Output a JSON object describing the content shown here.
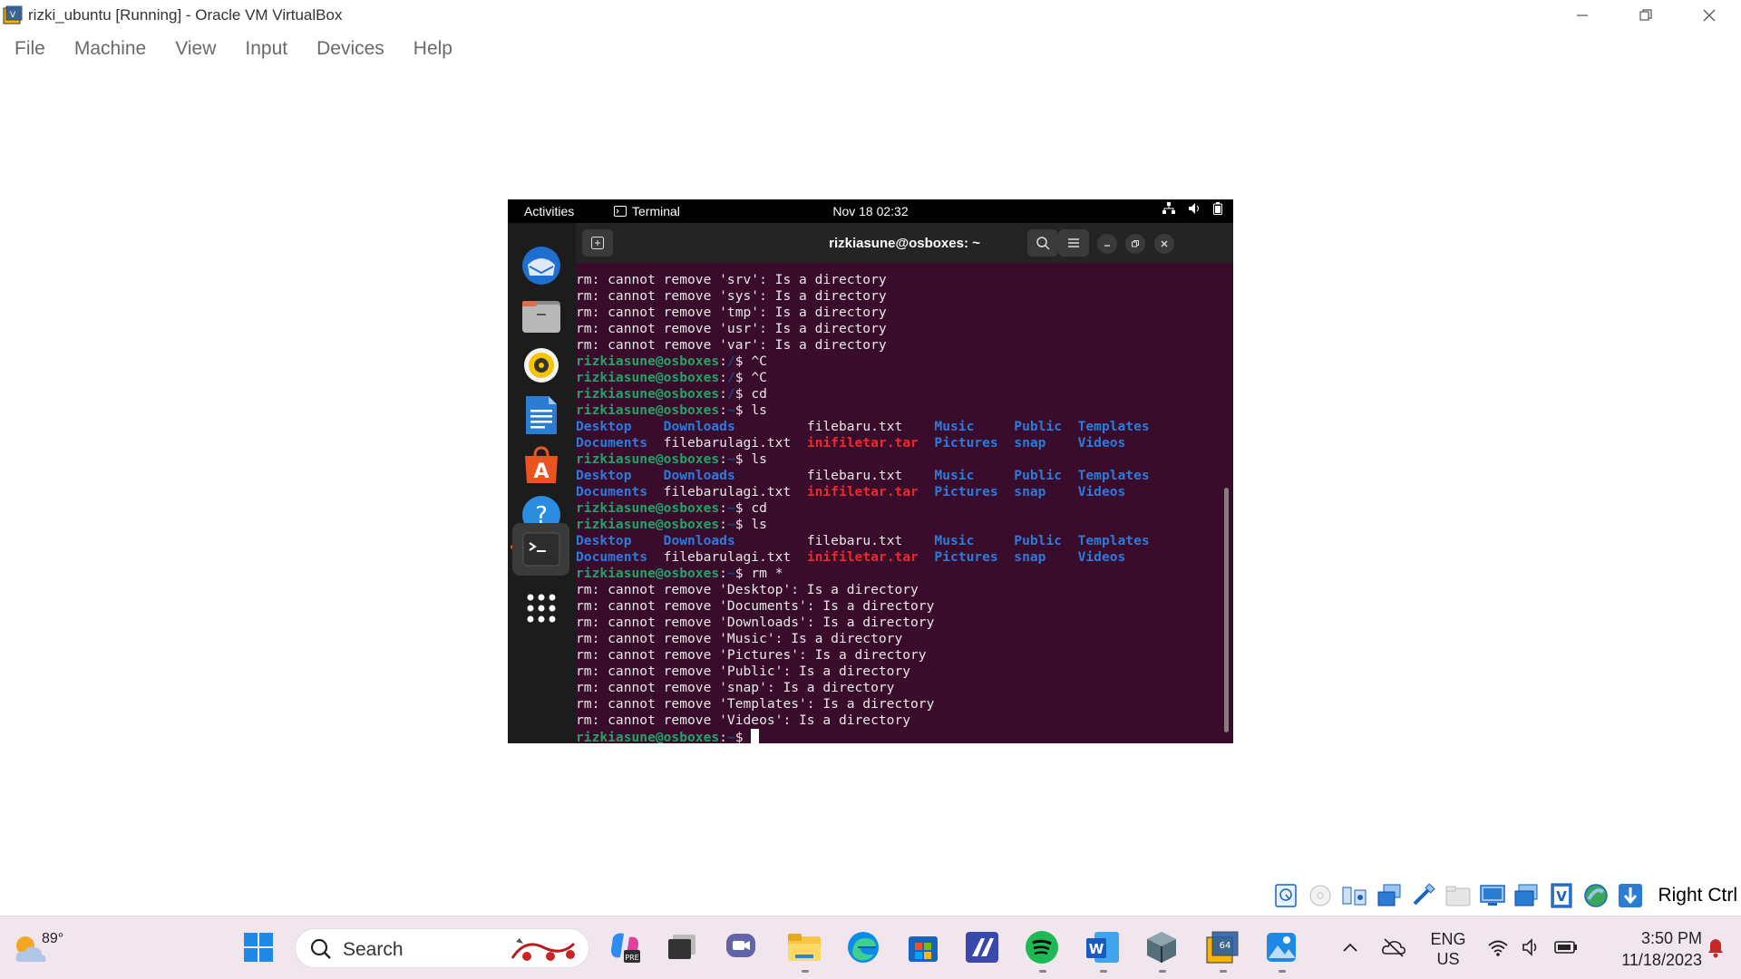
{
  "window": {
    "title": "rizki_ubuntu [Running] - Oracle VM VirtualBox"
  },
  "menubar": [
    "File",
    "Machine",
    "View",
    "Input",
    "Devices",
    "Help"
  ],
  "guest": {
    "topbar": {
      "activities": "Activities",
      "app_name": "Terminal",
      "clock": "Nov 18  02:32"
    },
    "dock": [
      "thunderbird-icon",
      "files-icon",
      "rhythmbox-icon",
      "writer-icon",
      "app-center-icon",
      "help-icon",
      "terminal-icon",
      "show-apps-icon"
    ],
    "terminal": {
      "title": "rizkiasune@osboxes: ~",
      "prompt_user": "rizkiasune@osboxes",
      "lines": [
        {
          "kind": "text",
          "text": "rm: cannot remove 'srv': Is a directory"
        },
        {
          "kind": "text",
          "text": "rm: cannot remove 'sys': Is a directory"
        },
        {
          "kind": "text",
          "text": "rm: cannot remove 'tmp': Is a directory"
        },
        {
          "kind": "text",
          "text": "rm: cannot remove 'usr': Is a directory"
        },
        {
          "kind": "text",
          "text": "rm: cannot remove 'var': Is a directory"
        },
        {
          "kind": "prompt",
          "path": "/",
          "cmd": " ^C"
        },
        {
          "kind": "prompt",
          "path": "/",
          "cmd": " ^C"
        },
        {
          "kind": "prompt",
          "path": "/",
          "cmd": " cd"
        },
        {
          "kind": "prompt",
          "path": "~",
          "cmd": " ls"
        },
        {
          "kind": "ls1"
        },
        {
          "kind": "ls2"
        },
        {
          "kind": "prompt",
          "path": "~",
          "cmd": " ls"
        },
        {
          "kind": "ls1"
        },
        {
          "kind": "ls2"
        },
        {
          "kind": "prompt",
          "path": "~",
          "cmd": " cd"
        },
        {
          "kind": "prompt",
          "path": "~",
          "cmd": " ls"
        },
        {
          "kind": "ls1"
        },
        {
          "kind": "ls2"
        },
        {
          "kind": "prompt",
          "path": "~",
          "cmd": " rm *"
        },
        {
          "kind": "text",
          "text": "rm: cannot remove 'Desktop': Is a directory"
        },
        {
          "kind": "text",
          "text": "rm: cannot remove 'Documents': Is a directory"
        },
        {
          "kind": "text",
          "text": "rm: cannot remove 'Downloads': Is a directory"
        },
        {
          "kind": "text",
          "text": "rm: cannot remove 'Music': Is a directory"
        },
        {
          "kind": "text",
          "text": "rm: cannot remove 'Pictures': Is a directory"
        },
        {
          "kind": "text",
          "text": "rm: cannot remove 'Public': Is a directory"
        },
        {
          "kind": "text",
          "text": "rm: cannot remove 'snap': Is a directory"
        },
        {
          "kind": "text",
          "text": "rm: cannot remove 'Templates': Is a directory"
        },
        {
          "kind": "text",
          "text": "rm: cannot remove 'Videos': Is a directory"
        },
        {
          "kind": "prompt",
          "path": "~",
          "cmd": " ",
          "cursor": true
        }
      ],
      "ls_row1": [
        {
          "t": "Desktop",
          "c": "dir",
          "w": 11
        },
        {
          "t": "Downloads",
          "c": "dir",
          "w": 18
        },
        {
          "t": "filebaru.txt",
          "c": "file",
          "w": 16
        },
        {
          "t": "Music",
          "c": "dir",
          "w": 10
        },
        {
          "t": "Public",
          "c": "dir",
          "w": 8
        },
        {
          "t": "Templates",
          "c": "dir",
          "w": 0
        }
      ],
      "ls_row2": [
        {
          "t": "Documents",
          "c": "dir",
          "w": 11
        },
        {
          "t": "filebarulagi.txt",
          "c": "file",
          "w": 18
        },
        {
          "t": "inifiletar.tar",
          "c": "archive",
          "w": 16
        },
        {
          "t": "Pictures",
          "c": "dir",
          "w": 10
        },
        {
          "t": "snap",
          "c": "dir",
          "w": 8
        },
        {
          "t": "Videos",
          "c": "dir",
          "w": 0
        }
      ]
    }
  },
  "vbox_status": {
    "host_key": "Right Ctrl"
  },
  "taskbar": {
    "weather_temp": "89°",
    "search_placeholder": "Search",
    "language": "ENG",
    "region": "US",
    "time": "3:50 PM",
    "date": "11/18/2023"
  },
  "colors": {
    "terminal_bg": "#380c2a",
    "prompt_user": "#26a269",
    "directory": "#2a7bde",
    "archive": "#ef2929"
  }
}
